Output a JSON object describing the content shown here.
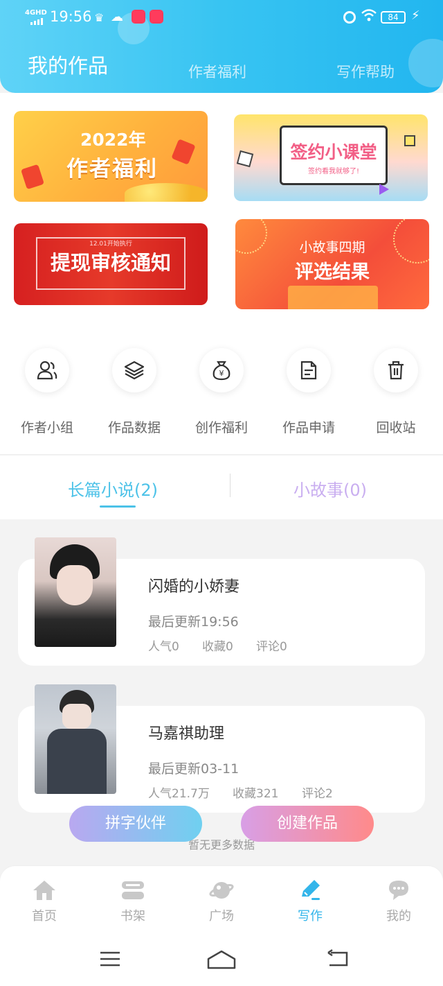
{
  "status_bar": {
    "network": "4GHD",
    "time": "19:56",
    "battery": "84"
  },
  "header": {
    "tabs": [
      {
        "label": "我的作品",
        "active": true
      },
      {
        "label": "作者福利",
        "active": false
      },
      {
        "label": "写作帮助",
        "active": false
      }
    ]
  },
  "banners": [
    {
      "year": "2022年",
      "title": "作者福利"
    },
    {
      "title": "签约小课堂",
      "subtitle": "签约看我就够了!"
    },
    {
      "small": "12.01开始执行",
      "title": "提现审核通知"
    },
    {
      "subtitle": "小故事四期",
      "title": "评选结果"
    }
  ],
  "quick_actions": [
    {
      "label": "作者小组",
      "icon": "group-icon"
    },
    {
      "label": "作品数据",
      "icon": "layers-icon"
    },
    {
      "label": "创作福利",
      "icon": "money-bag-icon"
    },
    {
      "label": "作品申请",
      "icon": "document-icon"
    },
    {
      "label": "回收站",
      "icon": "trash-icon"
    }
  ],
  "sub_tabs": [
    {
      "label": "长篇小说(2)",
      "active": true
    },
    {
      "label": "小故事(0)",
      "active": false
    }
  ],
  "works": [
    {
      "title": "闪婚的小娇妻",
      "updated": "最后更新19:56",
      "popularity": "人气0",
      "favorites": "收藏0",
      "comments": "评论0"
    },
    {
      "title": "马嘉祺助理",
      "updated": "最后更新03-11",
      "popularity": "人气21.7万",
      "favorites": "收藏321",
      "comments": "评论2"
    }
  ],
  "no_more": "暂无更多数据",
  "buttons": {
    "partner": "拼字伙伴",
    "create": "创建作品"
  },
  "bottom_nav": [
    {
      "label": "首页",
      "icon": "home-icon",
      "active": false
    },
    {
      "label": "书架",
      "icon": "bookshelf-icon",
      "active": false
    },
    {
      "label": "广场",
      "icon": "planet-icon",
      "active": false
    },
    {
      "label": "写作",
      "icon": "pen-icon",
      "active": true
    },
    {
      "label": "我的",
      "icon": "chat-bubble-icon",
      "active": false
    }
  ],
  "colors": {
    "accent": "#33b5ea",
    "header_gradient_start": "#5fd3f7",
    "header_gradient_end": "#22b6ef",
    "inactive_tab": "#c9aef0"
  }
}
